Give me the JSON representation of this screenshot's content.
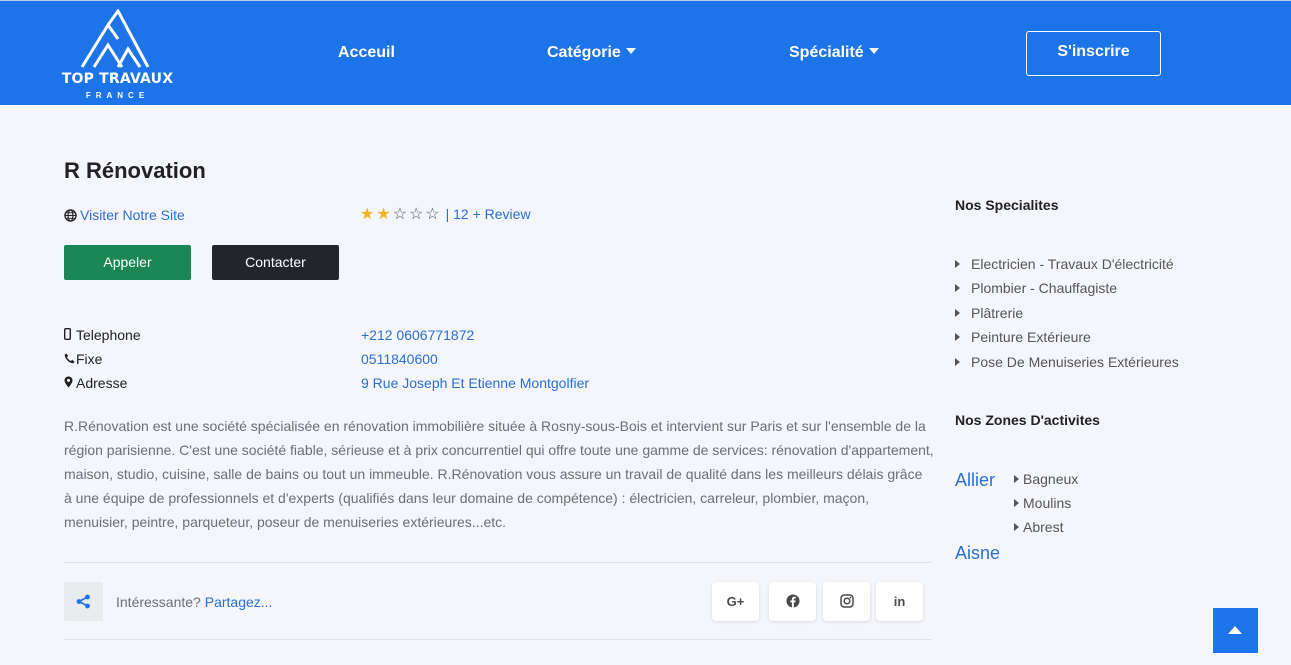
{
  "header": {
    "logo_title": "TOP TRAVAUX",
    "logo_subtitle": "FRANCE",
    "nav": {
      "home": "Acceuil",
      "category": "Catégorie",
      "specialty": "Spécialité"
    },
    "signup_label": "S'inscrire",
    "brand_color": "#1d73e8"
  },
  "company": {
    "name": "R Rénovation",
    "website_label": "Visiter Notre Site",
    "rating": {
      "value": 2,
      "max": 5,
      "review_label": "| 12 + Review"
    },
    "call_label": "Appeler",
    "contact_label": "Contacter",
    "info": [
      {
        "icon": "mobile-icon",
        "label": "Telephone",
        "value": "+212 0606771872"
      },
      {
        "icon": "phone-icon",
        "label": "Fixe",
        "value": "0511840600"
      },
      {
        "icon": "map-marker-icon",
        "label": "Adresse",
        "value": "9 Rue Joseph Et Etienne Montgolfier"
      }
    ],
    "description": "R.Rénovation est une société spécialisée en rénovation immobilière située à Rosny-sous-Bois et intervient sur Paris et sur l'ensemble de la région parisienne. C'est une société fiable, sérieuse et à prix concurrentiel qui offre toute une gamme de services: rénovation d'appartement, maison, studio, cuisine, salle de bains ou tout un immeuble. R.Rénovation vous assure un travail de qualité dans les meilleurs délais grâce à une équipe de professionnels et d'experts (qualifiés dans leur domaine de compétence) : électricien, carreleur, plombier, maçon, menuisier, peintre, parqueteur, poseur de menuiseries extérieures...etc."
  },
  "share": {
    "question": "Intéressante?",
    "link": "Partagez...",
    "networks": [
      {
        "name": "google-plus-icon",
        "label": "G+"
      },
      {
        "name": "facebook-icon",
        "label": ""
      },
      {
        "name": "instagram-icon",
        "label": ""
      },
      {
        "name": "linkedin-icon",
        "label": "in"
      }
    ]
  },
  "sidebar": {
    "specialties_title": "Nos Specialites",
    "specialties": [
      "Electricien - Travaux D'électricité",
      "Plombier - Chauffagiste",
      "Plâtrerie",
      "Peinture Extérieure",
      "Pose De Menuiseries Extérieures"
    ],
    "zones_title": "Nos Zones D'activites",
    "zones": [
      {
        "name": "Allier",
        "cities": [
          "Bagneux",
          "Moulins",
          "Abrest"
        ]
      },
      {
        "name": "Aisne",
        "cities": []
      }
    ]
  }
}
